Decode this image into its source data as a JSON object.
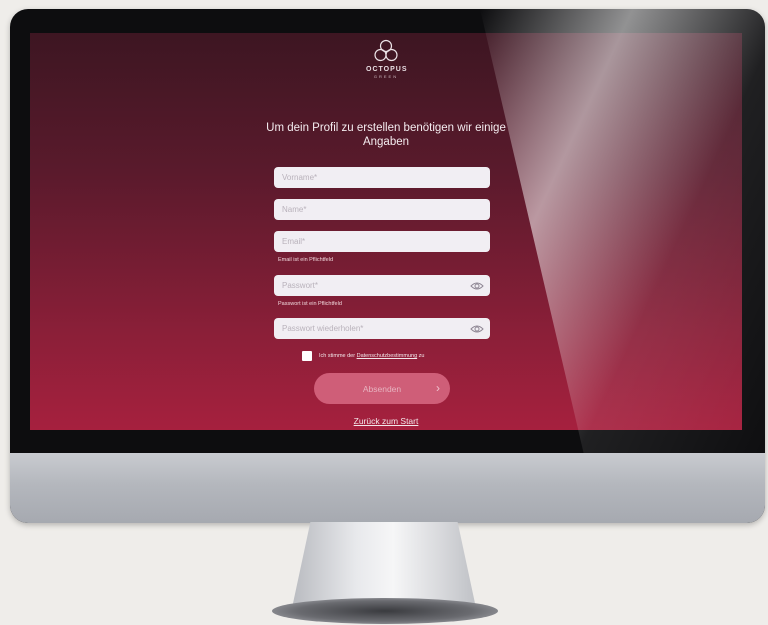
{
  "brand": {
    "name": "OCTOPUS",
    "sub": "GREEN"
  },
  "heading": "Um dein Profil zu erstellen benötigen wir einige Angaben",
  "fields": {
    "vorname": {
      "placeholder": "Vorname*"
    },
    "name": {
      "placeholder": "Name*"
    },
    "email": {
      "placeholder": "Email*",
      "error": "Email ist ein Pflichtfeld"
    },
    "passwort": {
      "placeholder": "Passwort*",
      "error": "Passwort ist ein Pflichtfeld"
    },
    "passwort_wiederholen": {
      "placeholder": "Passwort wiederholen*"
    }
  },
  "consent": {
    "prefix": "Ich stimme der ",
    "link": "Datenschutzbestimmung",
    "suffix": " zu"
  },
  "submit_label": "Absenden",
  "submit_arrow": "›",
  "back_link": "Zurück zum Start",
  "icons": {
    "eye": "eye-icon",
    "logo": "octopus-logo-icon",
    "arrow": "chevron-right-icon"
  },
  "colors": {
    "screen_top": "#3d1622",
    "screen_bottom": "#a6203e",
    "button": "#cf5e78",
    "field_bg": "#f1eef3"
  }
}
